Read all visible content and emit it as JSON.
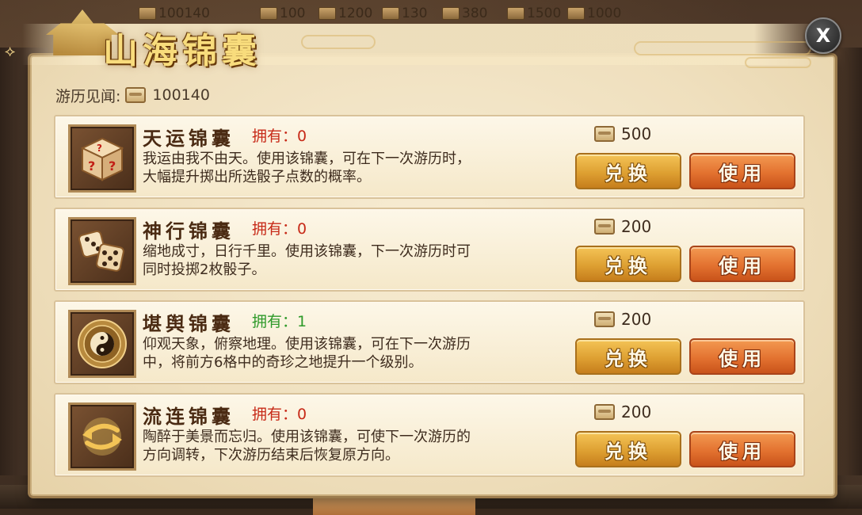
{
  "top_bar": {
    "currency": "100140",
    "resources": [
      "100",
      "1200",
      "130",
      "380",
      "1500",
      "1000"
    ]
  },
  "dialog": {
    "title": "山海锦囊",
    "close_label": "X",
    "balance_label": "游历见闻:",
    "balance_value": "100140"
  },
  "items": [
    {
      "name": "天运锦囊",
      "owned": "拥有：0",
      "owned_count": 0,
      "desc_line1": "我运由我不由天。使用该锦囊，可在下一次游历时，",
      "desc_line2": "大幅提升掷出所选骰子点数的概率。",
      "price": "500",
      "icon": "mystery-dice-icon",
      "exchange_label": "兑换",
      "use_label": "使用"
    },
    {
      "name": "神行锦囊",
      "owned": "拥有：0",
      "owned_count": 0,
      "desc_line1": "缩地成寸，日行千里。使用该锦囊，下一次游历时可",
      "desc_line2": "同时投掷2枚骰子。",
      "price": "200",
      "icon": "double-dice-icon",
      "exchange_label": "兑换",
      "use_label": "使用"
    },
    {
      "name": "堪舆锦囊",
      "owned": "拥有：1",
      "owned_count": 1,
      "desc_line1": "仰观天象，俯察地理。使用该锦囊，可在下一次游历",
      "desc_line2": "中，将前方6格中的奇珍之地提升一个级别。",
      "price": "200",
      "icon": "yin-yang-icon",
      "exchange_label": "兑换",
      "use_label": "使用"
    },
    {
      "name": "流连锦囊",
      "owned": "拥有：0",
      "owned_count": 0,
      "desc_line1": "陶醉于美景而忘归。使用该锦囊，可使下一次游历的",
      "desc_line2": "方向调转，下次游历结束后恢复原方向。",
      "price": "200",
      "icon": "reverse-arrows-icon",
      "exchange_label": "兑换",
      "use_label": "使用"
    }
  ],
  "colors": {
    "owned_zero": "#c72a18",
    "owned_positive": "#2f9a2a",
    "exchange_button": "#dea032",
    "use_button": "#e37230",
    "panel": "#efdfbd"
  }
}
